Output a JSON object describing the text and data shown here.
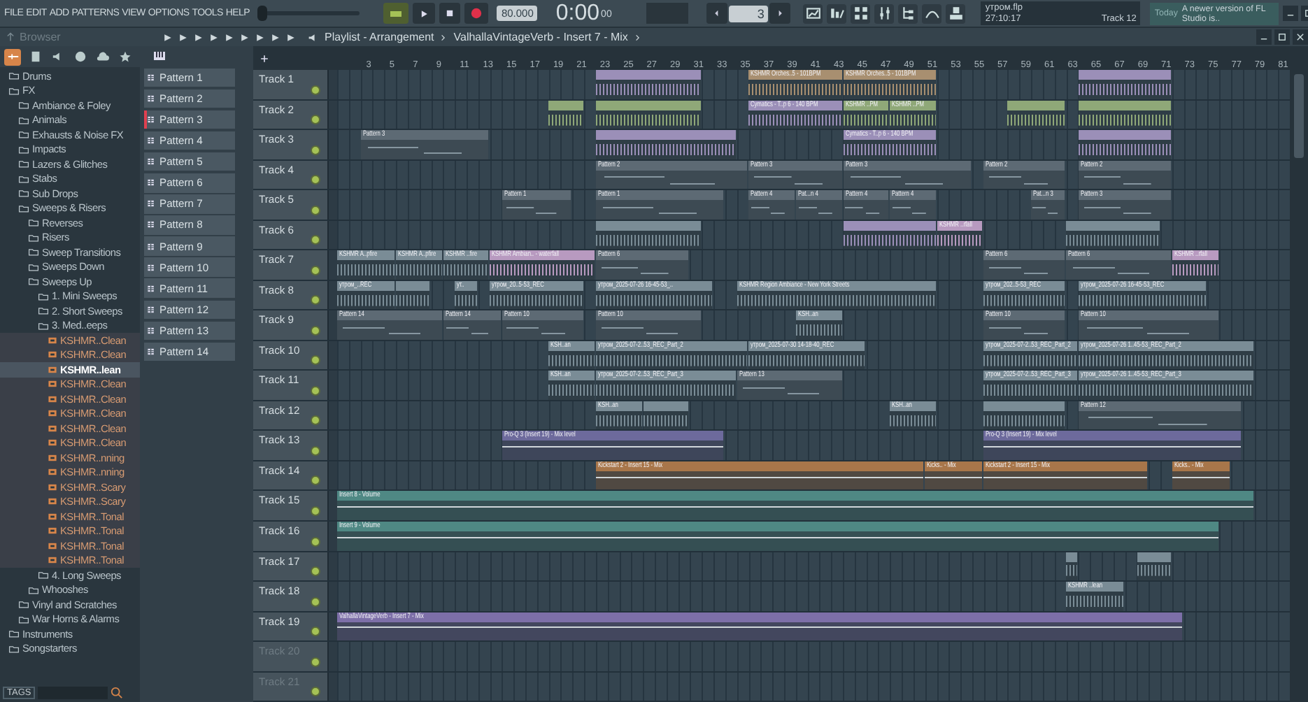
{
  "menu": [
    "FILE",
    "EDIT",
    "ADD",
    "PATTERNS",
    "VIEW",
    "OPTIONS",
    "TOOLS",
    "HELP"
  ],
  "master_volume": {
    "level": 0.0
  },
  "transport": {
    "tempo": "80.000",
    "time": "0:00",
    "time_fraction": "00",
    "pattern": "3"
  },
  "hint": {
    "file": "утром.flp",
    "time": "27:10:17",
    "track": "Track 12"
  },
  "news": {
    "when": "Today",
    "message": "A newer version of FL Studio is.."
  },
  "browser": {
    "title": "Browser",
    "tags": "TAGS",
    "tabs": [
      {
        "selected": true
      },
      {
        "selected": false
      },
      {
        "selected": false
      },
      {
        "selected": false
      },
      {
        "selected": false
      },
      {
        "selected": false
      }
    ],
    "items": [
      {
        "label": "Drums",
        "kind": "folder",
        "selected": false
      },
      {
        "label": "FX",
        "kind": "folder",
        "selected": false,
        "children": [
          {
            "label": "Ambiance & Foley",
            "kind": "folder",
            "selected": false
          },
          {
            "label": "Animals",
            "kind": "folder",
            "selected": false
          },
          {
            "label": "Exhausts & Noise FX",
            "kind": "folder",
            "selected": false
          },
          {
            "label": "Impacts",
            "kind": "folder",
            "selected": false
          },
          {
            "label": "Lazers & Glitches",
            "kind": "folder",
            "selected": false
          },
          {
            "label": "Stabs",
            "kind": "folder",
            "selected": false
          },
          {
            "label": "Sub Drops",
            "kind": "folder",
            "selected": false
          },
          {
            "label": "Sweeps & Risers",
            "kind": "folder",
            "selected": false,
            "children": [
              {
                "label": "Reverses",
                "kind": "folder",
                "selected": false
              },
              {
                "label": "Risers",
                "kind": "folder",
                "selected": false
              },
              {
                "label": "Sweep Transitions",
                "kind": "folder",
                "selected": false
              },
              {
                "label": "Sweeps Down",
                "kind": "folder",
                "selected": false
              },
              {
                "label": "Sweeps Up",
                "kind": "folder",
                "selected": false,
                "children": [
                  {
                    "label": "1. Mini Sweeps",
                    "kind": "folder",
                    "selected": false
                  },
                  {
                    "label": "2. Short Sweeps",
                    "kind": "folder",
                    "selected": false
                  },
                  {
                    "label": "3. Med..eeps",
                    "kind": "folder",
                    "selected": false,
                    "children": [
                      {
                        "label": "KSHMR..Clean",
                        "kind": "file",
                        "selected": false
                      },
                      {
                        "label": "KSHMR..Clean",
                        "kind": "file",
                        "selected": false
                      },
                      {
                        "label": "KSHMR..lean",
                        "kind": "file",
                        "selected": true
                      },
                      {
                        "label": "KSHMR..Clean",
                        "kind": "file",
                        "selected": false
                      },
                      {
                        "label": "KSHMR..Clean",
                        "kind": "file",
                        "selected": false
                      },
                      {
                        "label": "KSHMR..Clean",
                        "kind": "file",
                        "selected": false
                      },
                      {
                        "label": "KSHMR..Clean",
                        "kind": "file",
                        "selected": false
                      },
                      {
                        "label": "KSHMR..Clean",
                        "kind": "file",
                        "selected": false
                      },
                      {
                        "label": "KSHMR..nning",
                        "kind": "file",
                        "selected": false
                      },
                      {
                        "label": "KSHMR..nning",
                        "kind": "file",
                        "selected": false
                      },
                      {
                        "label": "KSHMR..Scary",
                        "kind": "file",
                        "selected": false
                      },
                      {
                        "label": "KSHMR..Scary",
                        "kind": "file",
                        "selected": false
                      },
                      {
                        "label": "KSHMR..Tonal",
                        "kind": "file",
                        "selected": false
                      },
                      {
                        "label": "KSHMR..Tonal",
                        "kind": "file",
                        "selected": false
                      },
                      {
                        "label": "KSHMR..Tonal",
                        "kind": "file",
                        "selected": false
                      },
                      {
                        "label": "KSHMR..Tonal",
                        "kind": "file",
                        "selected": false
                      }
                    ]
                  },
                  {
                    "label": "4. Long Sweeps",
                    "kind": "folder",
                    "selected": false
                  }
                ]
              },
              {
                "label": "Whooshes",
                "kind": "folder",
                "selected": false
              }
            ]
          },
          {
            "label": "Vinyl and Scratches",
            "kind": "folder",
            "selected": false
          },
          {
            "label": "War Horns & Alarms",
            "kind": "folder",
            "selected": false
          }
        ]
      },
      {
        "label": "Instruments",
        "kind": "folder",
        "selected": false
      },
      {
        "label": "Songstarters",
        "kind": "folder",
        "selected": false
      }
    ]
  },
  "patterns": [
    {
      "label": "Pattern 1",
      "selected": false
    },
    {
      "label": "Pattern 2",
      "selected": false
    },
    {
      "label": "Pattern 3",
      "selected": true
    },
    {
      "label": "Pattern 4",
      "selected": false
    },
    {
      "label": "Pattern 5",
      "selected": false
    },
    {
      "label": "Pattern 6",
      "selected": false
    },
    {
      "label": "Pattern 7",
      "selected": false
    },
    {
      "label": "Pattern 8",
      "selected": false
    },
    {
      "label": "Pattern 9",
      "selected": false
    },
    {
      "label": "Pattern 10",
      "selected": false
    },
    {
      "label": "Pattern 11",
      "selected": false
    },
    {
      "label": "Pattern 12",
      "selected": false
    },
    {
      "label": "Pattern 13",
      "selected": false
    },
    {
      "label": "Pattern 14",
      "selected": false
    }
  ],
  "playlist": {
    "breadcrumb": [
      "Playlist - Arrangement",
      "ValhallaVintageVerb - Insert 7 - Mix"
    ],
    "ruler": [
      "3",
      "5",
      "7",
      "9",
      "11",
      "13",
      "15",
      "17",
      "19",
      "21",
      "23",
      "25",
      "27",
      "29",
      "31",
      "33",
      "35",
      "37",
      "39",
      "41",
      "43",
      "45",
      "47",
      "49",
      "51",
      "53",
      "55",
      "57",
      "59",
      "61",
      "63",
      "65",
      "67",
      "69",
      "71",
      "73",
      "75",
      "77",
      "79",
      "81"
    ],
    "tracks": [
      {
        "name": "Track 1",
        "empty": false,
        "clips": [
          {
            "kind": "audio",
            "color": "#9b8fb8"
          },
          {
            "kind": "audio",
            "color": "#a88f70",
            "label": "KSHMR Orches..5 - 101BPM"
          },
          {
            "kind": "audio",
            "color": "#a88f70",
            "label": "KSHMR Orches..5 - 101BPM"
          },
          {
            "kind": "audio",
            "color": "#9b8fb8"
          }
        ]
      },
      {
        "name": "Track 2",
        "empty": false,
        "clips": [
          {
            "kind": "audio",
            "color": "#8fa878"
          },
          {
            "kind": "audio",
            "color": "#8fa878"
          },
          {
            "kind": "audio",
            "color": "#9b8fb8",
            "label": "Cymatics - T..p 6 - 140 BPM"
          },
          {
            "kind": "audio",
            "color": "#8fa878",
            "label": "KSHMR ..PM"
          },
          {
            "kind": "audio",
            "color": "#8fa878",
            "label": "KSHMR ..PM"
          },
          {
            "kind": "audio",
            "color": "#8fa878"
          },
          {
            "kind": "audio",
            "color": "#8fa878"
          }
        ]
      },
      {
        "name": "Track 3",
        "empty": false,
        "clips": [
          {
            "kind": "pattern",
            "color": "#5d6a74",
            "label": "Pattern 3"
          },
          {
            "kind": "audio",
            "color": "#9b8fb8"
          },
          {
            "kind": "audio",
            "color": "#9b8fb8",
            "label": "Cymatics - T..p 6 - 140 BPM"
          },
          {
            "kind": "audio",
            "color": "#9b8fb8"
          }
        ]
      },
      {
        "name": "Track 4",
        "empty": false,
        "clips": [
          {
            "kind": "pattern",
            "color": "#5d6a74",
            "label": "Pattern 2"
          },
          {
            "kind": "pattern",
            "color": "#5d6a74",
            "label": "Pattern 3"
          },
          {
            "kind": "pattern",
            "color": "#5d6a74",
            "label": "Pattern 3"
          },
          {
            "kind": "pattern",
            "color": "#5d6a74",
            "label": "Pattern 2"
          },
          {
            "kind": "pattern",
            "color": "#5d6a74",
            "label": "Pattern 2"
          }
        ]
      },
      {
        "name": "Track 5",
        "empty": false,
        "clips": [
          {
            "kind": "pattern",
            "color": "#5d6a74",
            "label": "Pattern 1"
          },
          {
            "kind": "pattern",
            "color": "#5d6a74",
            "label": "Pattern 1"
          },
          {
            "kind": "pattern",
            "color": "#5d6a74",
            "label": "Pattern 4"
          },
          {
            "kind": "pattern",
            "color": "#5d6a74",
            "label": "Pat...n 4"
          },
          {
            "kind": "pattern",
            "color": "#5d6a74",
            "label": "Pattern 4"
          },
          {
            "kind": "pattern",
            "color": "#5d6a74",
            "label": "Pattern 4"
          },
          {
            "kind": "pattern",
            "color": "#5d6a74",
            "label": "Pat...n 3"
          },
          {
            "kind": "pattern",
            "color": "#5d6a74",
            "label": "Pattern 3"
          }
        ]
      },
      {
        "name": "Track 6",
        "empty": false,
        "clips": [
          {
            "kind": "audio",
            "color": "#7a8c96"
          },
          {
            "kind": "audio",
            "color": "#9b8fb8"
          },
          {
            "kind": "audio",
            "color": "#b89ac0",
            "label": "KSHMR ..rfall"
          },
          {
            "kind": "audio",
            "color": "#7a8c96"
          }
        ]
      },
      {
        "name": "Track 7",
        "empty": false,
        "clips": [
          {
            "kind": "audio",
            "color": "#7a8c96",
            "label": "KSHMR A..pfire"
          },
          {
            "kind": "audio",
            "color": "#7a8c96",
            "label": "KSHMR A..pfire"
          },
          {
            "kind": "audio",
            "color": "#7a8c96",
            "label": "KSHMR ..fire"
          },
          {
            "kind": "audio",
            "color": "#b89ac0",
            "label": "KSHMR Ambian.. - waterfall"
          },
          {
            "kind": "pattern",
            "color": "#5d6a74",
            "label": "Pattern 6"
          },
          {
            "kind": "pattern",
            "color": "#5d6a74",
            "label": "Pattern 6"
          },
          {
            "kind": "pattern",
            "color": "#5d6a74",
            "label": "Pattern 6"
          },
          {
            "kind": "audio",
            "color": "#b89ac0",
            "label": "KSHMR ..rfall"
          }
        ]
      },
      {
        "name": "Track 8",
        "empty": false,
        "clips": [
          {
            "kind": "audio",
            "color": "#7a8c96",
            "label": "утром_..REC"
          },
          {
            "kind": "audio",
            "color": "#7a8c96"
          },
          {
            "kind": "audio",
            "color": "#7a8c96",
            "label": "ут.."
          },
          {
            "kind": "audio",
            "color": "#7a8c96",
            "label": "утром_20..5-53_REC"
          },
          {
            "kind": "audio",
            "color": "#7a8c96",
            "label": "утром_2025-07-26 16-45-53_.."
          },
          {
            "kind": "audio",
            "color": "#7a8c96",
            "label": "KSHMR Region Ambiance - New York Streets"
          },
          {
            "kind": "audio",
            "color": "#7a8c96",
            "label": "утром_202..5-53_REC"
          },
          {
            "kind": "audio",
            "color": "#7a8c96",
            "label": "утром_2025-07-26 16-45-53_REC"
          }
        ]
      },
      {
        "name": "Track 9",
        "empty": false,
        "clips": [
          {
            "kind": "pattern",
            "color": "#5d6a74",
            "label": "Pattern 14"
          },
          {
            "kind": "pattern",
            "color": "#5d6a74",
            "label": "Pattern 14"
          },
          {
            "kind": "pattern",
            "color": "#5d6a74",
            "label": "Pattern 10"
          },
          {
            "kind": "pattern",
            "color": "#5d6a74",
            "label": "Pattern 10"
          },
          {
            "kind": "audio",
            "color": "#7a8c96",
            "label": "KSH..an"
          },
          {
            "kind": "pattern",
            "color": "#5d6a74",
            "label": "Pattern 10"
          },
          {
            "kind": "pattern",
            "color": "#5d6a74",
            "label": "Pattern 10"
          }
        ]
      },
      {
        "name": "Track 10",
        "empty": false,
        "clips": [
          {
            "kind": "audio",
            "color": "#7a8c96",
            "label": "KSH..an"
          },
          {
            "kind": "audio",
            "color": "#7a8c96",
            "label": "утром_2025-07-2..53_REC_Part_2"
          },
          {
            "kind": "audio",
            "color": "#7a8c96",
            "label": "утром_2025-07-30 14-18-40_REC"
          },
          {
            "kind": "audio",
            "color": "#7a8c96",
            "label": "утром_2025-07-2..53_REC_Part_2"
          },
          {
            "kind": "audio",
            "color": "#7a8c96",
            "label": "утром_2025-07-26 1..45-53_REC_Part_2"
          }
        ]
      },
      {
        "name": "Track 11",
        "empty": false,
        "clips": [
          {
            "kind": "audio",
            "color": "#7a8c96",
            "label": "KSH..an"
          },
          {
            "kind": "audio",
            "color": "#7a8c96",
            "label": "утром_2025-07-2..53_REC_Part_3"
          },
          {
            "kind": "pattern",
            "color": "#5d6a74",
            "label": "Pattern 13"
          },
          {
            "kind": "audio",
            "color": "#7a8c96",
            "label": "утром_2025-07-2..53_REC_Part_3"
          },
          {
            "kind": "audio",
            "color": "#7a8c96",
            "label": "утром_2025-07-26 1..45-53_REC_Part_3"
          }
        ]
      },
      {
        "name": "Track 12",
        "empty": false,
        "clips": [
          {
            "kind": "audio",
            "color": "#7a8c96",
            "label": "KSH..an"
          },
          {
            "kind": "audio",
            "color": "#7a8c96"
          },
          {
            "kind": "audio",
            "color": "#7a8c96",
            "label": "KSH..an"
          },
          {
            "kind": "audio",
            "color": "#7a8c96"
          },
          {
            "kind": "pattern",
            "color": "#5d6a74",
            "label": "Pattern 12"
          }
        ]
      },
      {
        "name": "Track 13",
        "empty": false,
        "clips": [
          {
            "kind": "automation",
            "color": "#6d6a9c",
            "label": "Pro-Q 3 (Insert 19) - Mix level"
          },
          {
            "kind": "automation",
            "color": "#6d6a9c",
            "label": "Pro-Q 3 (Insert 19) - Mix level"
          }
        ]
      },
      {
        "name": "Track 14",
        "empty": false,
        "clips": [
          {
            "kind": "automation",
            "color": "#a8764a",
            "label": "Kickstart 2 - Insert 15 - Mix"
          },
          {
            "kind": "automation",
            "color": "#a8764a",
            "label": "Kicks.. - Mix"
          },
          {
            "kind": "automation",
            "color": "#a8764a",
            "label": "Kickstart 2 - Insert 15 - Mix"
          },
          {
            "kind": "automation",
            "color": "#a8764a",
            "label": "Kicks.. - Mix"
          }
        ]
      },
      {
        "name": "Track 15",
        "empty": false,
        "clips": [
          {
            "kind": "automation",
            "color": "#4f8884",
            "label": "Insert 8 - Volume"
          }
        ]
      },
      {
        "name": "Track 16",
        "empty": false,
        "clips": [
          {
            "kind": "automation",
            "color": "#4f8884",
            "label": "Insert 9 - Volume"
          }
        ]
      },
      {
        "name": "Track 17",
        "empty": false,
        "clips": [
          {
            "kind": "audio",
            "color": "#7a8c96"
          },
          {
            "kind": "audio",
            "color": "#7a8c96"
          }
        ]
      },
      {
        "name": "Track 18",
        "empty": false,
        "clips": [
          {
            "kind": "audio",
            "color": "#7a8c96",
            "label": "KSHMR ..lean"
          }
        ]
      },
      {
        "name": "Track 19",
        "empty": false,
        "clips": [
          {
            "kind": "automation",
            "color": "#7d6fa8",
            "label": "ValhallaVintageVerb - Insert 7 - Mix"
          }
        ]
      },
      {
        "name": "Track 20",
        "empty": true
      },
      {
        "name": "Track 21",
        "empty": true
      }
    ]
  }
}
